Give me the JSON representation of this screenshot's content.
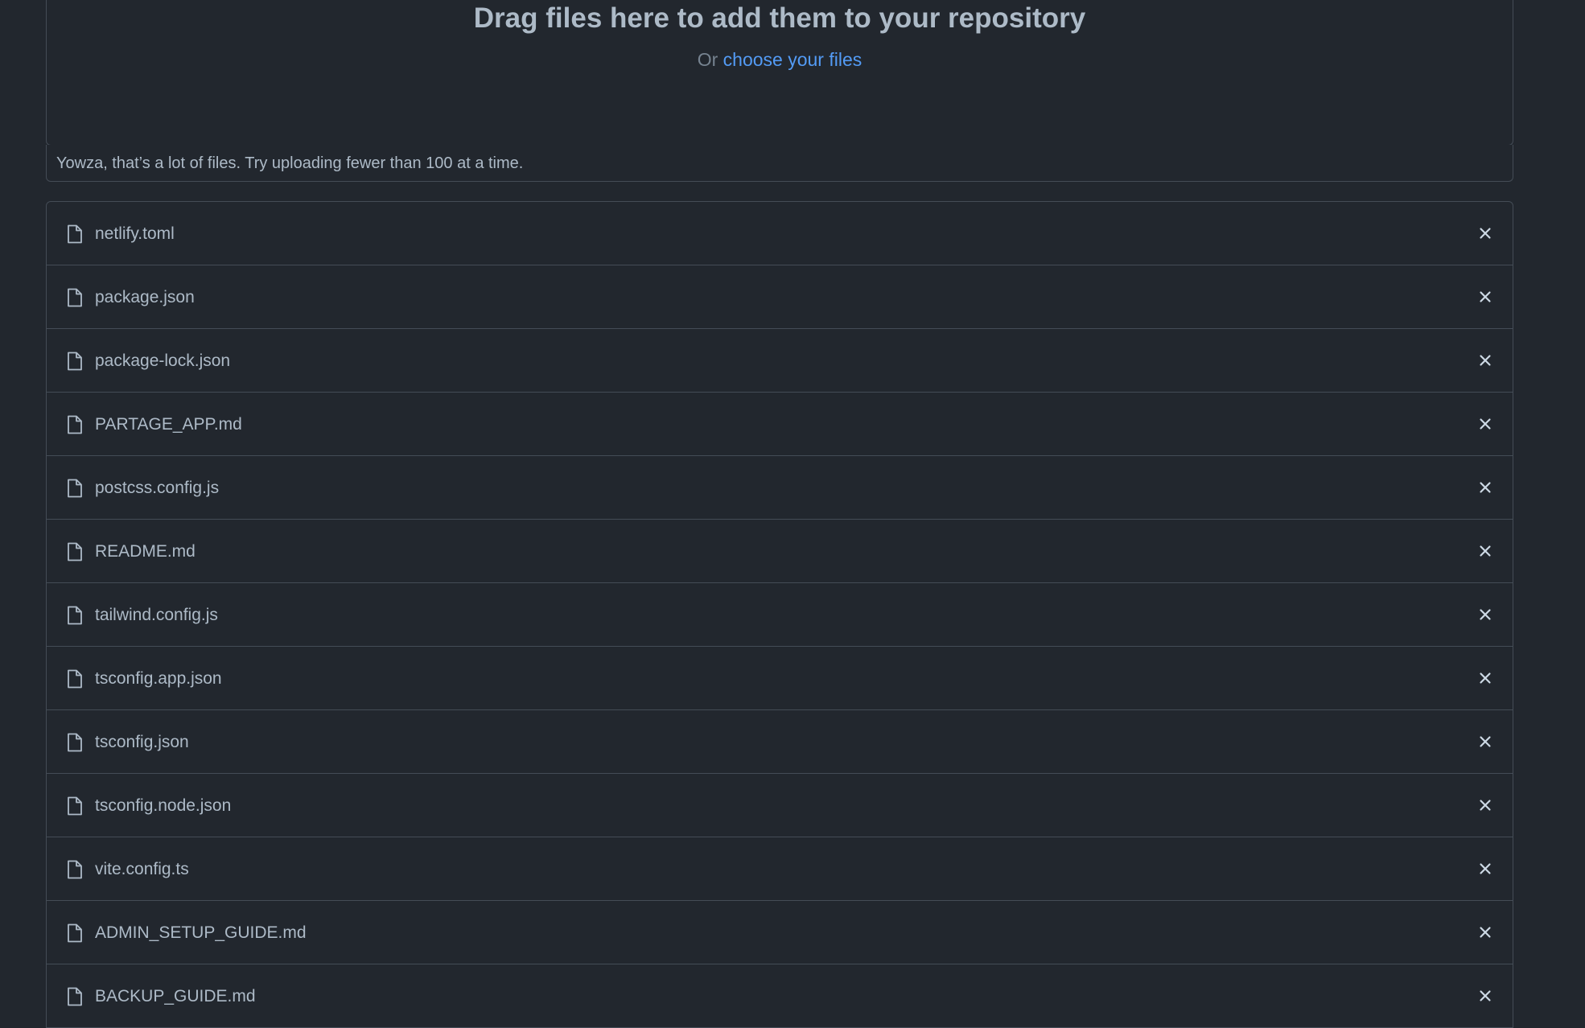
{
  "dropzone": {
    "title": "Drag files here to add them to your repository",
    "or_text": "Or",
    "choose_link": "choose your files"
  },
  "warning": {
    "message": "Yowza, that’s a lot of files. Try uploading fewer than 100 at a time."
  },
  "files": [
    {
      "name": "netlify.toml"
    },
    {
      "name": "package.json"
    },
    {
      "name": "package-lock.json"
    },
    {
      "name": "PARTAGE_APP.md"
    },
    {
      "name": "postcss.config.js"
    },
    {
      "name": "README.md"
    },
    {
      "name": "tailwind.config.js"
    },
    {
      "name": "tsconfig.app.json"
    },
    {
      "name": "tsconfig.json"
    },
    {
      "name": "tsconfig.node.json"
    },
    {
      "name": "vite.config.ts"
    },
    {
      "name": "ADMIN_SETUP_GUIDE.md"
    },
    {
      "name": "BACKUP_GUIDE.md"
    }
  ],
  "icons": {
    "file": "file-icon",
    "remove": "x-close-icon"
  },
  "colors": {
    "background": "#22272e",
    "border": "#444c56",
    "text": "#adbac7",
    "muted": "#768390",
    "link": "#539bf5"
  }
}
